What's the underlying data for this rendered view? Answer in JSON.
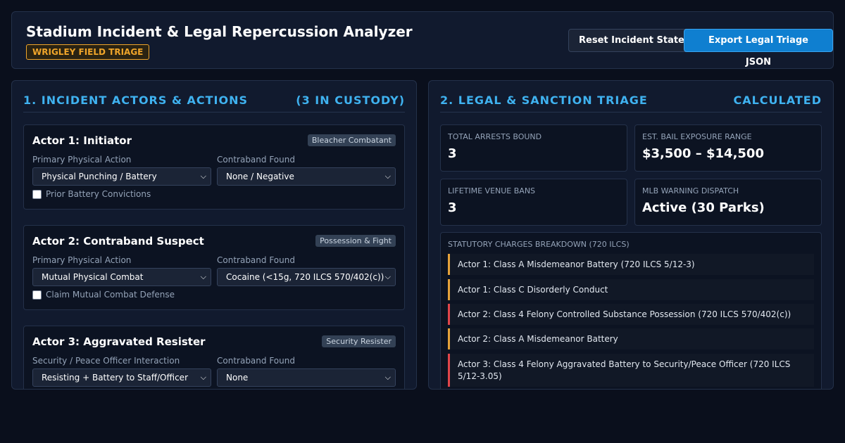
{
  "header": {
    "title": "Stadium Incident & Legal Repercussion Analyzer",
    "venue_badge": "WRIGLEY FIELD TRIAGE",
    "reset_label": "Reset Incident State",
    "export_label": "Export Legal Triage JSON"
  },
  "left_panel": {
    "title": "1. INCIDENT ACTORS & ACTIONS",
    "count": "(3 IN CUSTODY)",
    "actors": [
      {
        "name": "Actor 1: Initiator",
        "tag": "Bleacher Combatant",
        "action_label": "Primary Physical Action",
        "action_value": "Physical Punching / Battery",
        "contraband_label": "Contraband Found",
        "contraband_value": "None / Negative",
        "checkbox_label": "Prior Battery Convictions"
      },
      {
        "name": "Actor 2: Contraband Suspect",
        "tag": "Possession & Fight",
        "action_label": "Primary Physical Action",
        "action_value": "Mutual Physical Combat",
        "contraband_label": "Contraband Found",
        "contraband_value": "Cocaine (<15g, 720 ILCS 570/402(c))",
        "checkbox_label": "Claim Mutual Combat Defense"
      },
      {
        "name": "Actor 3: Aggravated Resister",
        "tag": "Security Resister",
        "action_label": "Security / Peace Officer Interaction",
        "action_value": "Resisting + Battery to Staff/Officer",
        "contraband_label": "Contraband Found",
        "contraband_value": "None"
      }
    ]
  },
  "right_panel": {
    "title": "2. LEGAL & SANCTION TRIAGE",
    "status": "CALCULATED",
    "stats": [
      {
        "label": "TOTAL ARRESTS BOUND",
        "value": "3"
      },
      {
        "label": "EST. BAIL EXPOSURE RANGE",
        "value": "$3,500 – $14,500"
      },
      {
        "label": "LIFETIME VENUE BANS",
        "value": "3"
      },
      {
        "label": "MLB WARNING DISPATCH",
        "value": "Active (30 Parks)"
      }
    ],
    "charges_title": "STATUTORY CHARGES BREAKDOWN (720 ILCS)",
    "charges": [
      {
        "text": "Actor 1: Class A Misdemeanor Battery (720 ILCS 5/12-3)",
        "severity": "misdemeanor",
        "color": "#e6a23a"
      },
      {
        "text": "Actor 1: Class C Disorderly Conduct",
        "severity": "misdemeanor",
        "color": "#e6a23a"
      },
      {
        "text": "Actor 2: Class 4 Felony Controlled Substance Possession (720 ILCS 570/402(c))",
        "severity": "felony",
        "color": "#e0454a"
      },
      {
        "text": "Actor 2: Class A Misdemeanor Battery",
        "severity": "misdemeanor",
        "color": "#e6a23a"
      },
      {
        "text": "Actor 3: Class 4 Felony Aggravated Battery to Security/Peace Officer (720 ILCS 5/12-3.05)",
        "severity": "felony",
        "color": "#e0454a"
      }
    ]
  },
  "colors": {
    "accent": "#3fb2f0",
    "warning": "#f0a52a",
    "felony": "#e0454a",
    "primary_button": "#0f7fd0"
  }
}
